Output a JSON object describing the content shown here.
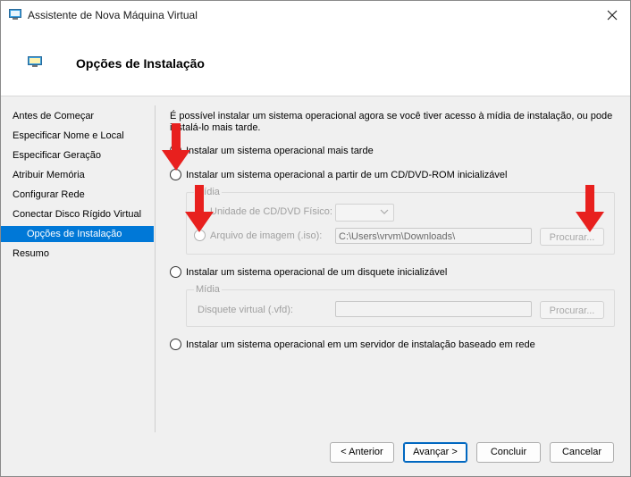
{
  "window": {
    "title": "Assistente de Nova Máquina Virtual"
  },
  "header": {
    "title": "Opções de Instalação"
  },
  "sidebar": {
    "items": [
      {
        "label": "Antes de Começar"
      },
      {
        "label": "Especificar Nome e Local"
      },
      {
        "label": "Especificar Geração"
      },
      {
        "label": "Atribuir Memória"
      },
      {
        "label": "Configurar Rede"
      },
      {
        "label": "Conectar Disco Rígido Virtual"
      },
      {
        "label": "Opções de Instalação",
        "active": true
      },
      {
        "label": "Resumo"
      }
    ]
  },
  "main": {
    "intro": "É possível instalar um sistema operacional agora se você tiver acesso à mídia de instalação, ou pode instalá-lo mais tarde.",
    "options": {
      "later": "Instalar um sistema operacional mais tarde",
      "cd": "Instalar um sistema operacional a partir de um CD/DVD-ROM inicializável",
      "floppy": "Instalar um sistema operacional de um disquete inicializável",
      "network": "Instalar um sistema operacional em um servidor de instalação baseado em rede"
    },
    "cd_group": {
      "label": "Mídia",
      "physical_label": "Unidade de CD/DVD Físico:",
      "physical_value": "",
      "image_label": "Arquivo de imagem (.iso):",
      "image_value": "C:\\Users\\vrvm\\Downloads\\",
      "browse": "Procurar..."
    },
    "floppy_group": {
      "label": "Mídia",
      "vfd_label": "Disquete virtual (.vfd):",
      "vfd_value": "",
      "browse": "Procurar..."
    }
  },
  "footer": {
    "previous": "< Anterior",
    "next": "Avançar >",
    "finish": "Concluir",
    "cancel": "Cancelar"
  },
  "colors": {
    "accent": "#0078d7",
    "annotation_arrow": "#e8201e"
  }
}
